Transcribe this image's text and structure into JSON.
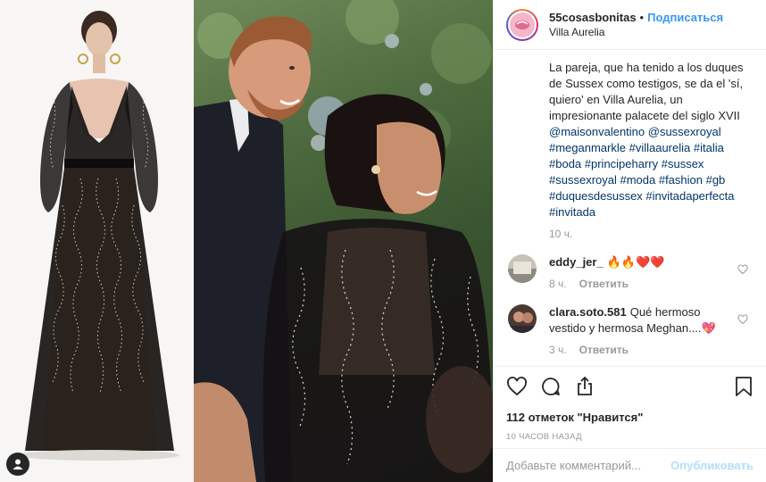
{
  "post": {
    "username": "55cosasbonitas",
    "separator": "•",
    "follow_label": "Подписаться",
    "location": "Villa Aurelia",
    "caption_text": "La pareja, que ha tenido a los duques de Sussex como testigos, se da el 'sí, quiero' en Villa Aurelia, un impresionante palacete del siglo XVII",
    "caption_tags": "@maisonvalentino @sussexroyal #meganmarkle #villaaurelia #italia #boda #principeharry #sussex #sussexroyal #moda #fashion #gb #duquesdesussex #invitadaperfecta #invitada",
    "caption_time": "10 ч.",
    "comments": [
      {
        "user": "eddy_jer_",
        "text": "🔥🔥❤️❤️",
        "time": "8 ч.",
        "reply_label": "Ответить"
      },
      {
        "user": "clara.soto.581",
        "text": "Qué hermoso vestido y hermosa Meghan....💖",
        "time": "3 ч.",
        "reply_label": "Ответить"
      }
    ],
    "likes": "112 отметок \"Нравится\"",
    "time_ago": "10 ЧАСОВ НАЗАД",
    "add_comment_placeholder": "Добавьте комментарий...",
    "publish_label": "Опубликовать"
  },
  "icons": {
    "like": "heart-icon",
    "comment": "comment-icon",
    "share": "share-icon",
    "save": "bookmark-icon",
    "tag": "user-tag-icon"
  },
  "colors": {
    "accent": "#3897f0",
    "tag": "#003569",
    "muted": "#999999",
    "publish_disabled": "#b2dffc"
  }
}
